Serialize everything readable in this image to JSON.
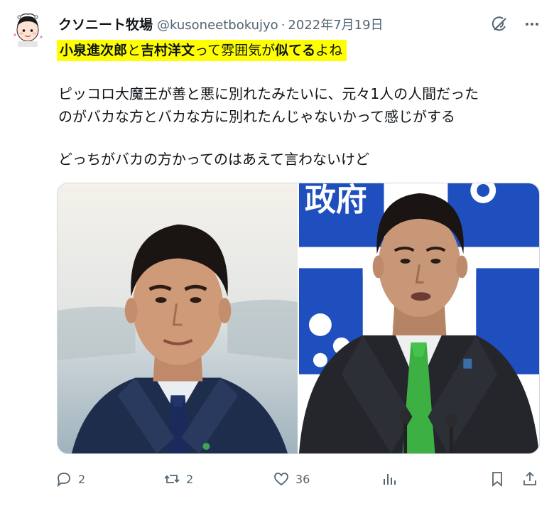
{
  "tweet": {
    "display_name": "クソニート牧場",
    "handle": "@kusoneetbokujyo",
    "separator": "·",
    "date": "2022年7月19日",
    "avatar_caption": "クソニート牧場",
    "highlight": {
      "part1": "小泉進次郎",
      "part2": "と",
      "part3": "吉村洋文",
      "part4": "って雰囲気が",
      "part5": "似てる",
      "part6": "よね"
    },
    "body_line1": "ピッコロ大魔王が善と悪に別れたみたいに、元々1人の人間だった",
    "body_line2": "のがバカな方とバカな方に別れたんじゃないかって感じがする",
    "body_line3": "どっちがバカの方かってのはあえて言わないけど",
    "right_photo_sign": "政府"
  },
  "actions": {
    "reply_count": "2",
    "retweet_count": "2",
    "like_count": "36"
  },
  "icons": [
    "grok-icon",
    "more-icon",
    "reply-icon",
    "retweet-icon",
    "like-icon",
    "views-icon",
    "bookmark-icon",
    "share-icon"
  ],
  "colors": {
    "highlight": "#ffff00",
    "muted_text": "#536471",
    "text": "#0f1419",
    "tie_left": "#1a2a5a",
    "tie_right": "#3cb043",
    "backdrop_blue": "#1f4fbf"
  }
}
